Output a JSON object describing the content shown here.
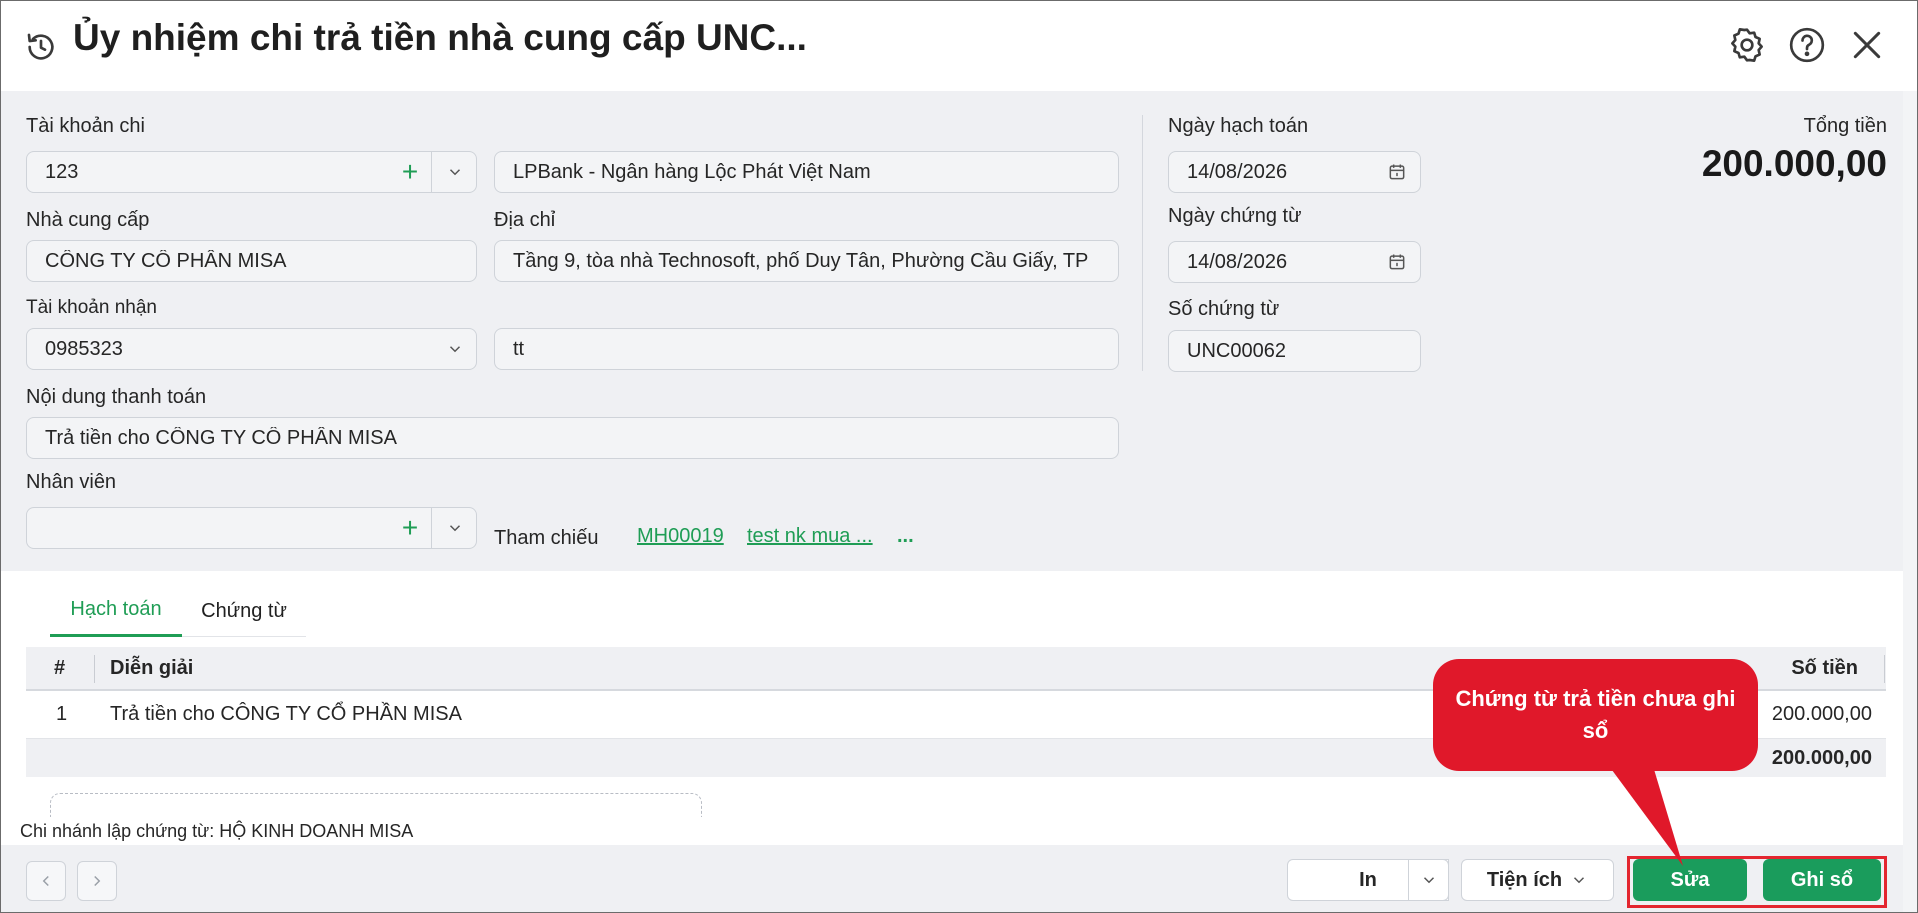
{
  "header": {
    "title": "Ủy nhiệm chi trả tiền nhà cung cấp UNC...",
    "icons": [
      "history-icon",
      "gear-icon",
      "help-icon",
      "close-icon"
    ]
  },
  "form": {
    "account_label": "Tài khoản chi",
    "account_value": "123",
    "bank_value": "LPBank - Ngân hàng Lộc Phát Việt Nam",
    "supplier_label": "Nhà cung cấp",
    "supplier_value": "CÔNG TY CÔ PHÂN MISA",
    "address_label": "Địa chỉ",
    "address_value": "Tầng 9, tòa nhà Technosoft, phố Duy Tân, Phường Cầu Giấy, TP",
    "receive_account_label": "Tài khoản nhận",
    "receive_account_value": "0985323",
    "receive_bank_value": "tt",
    "content_label": "Nội dung thanh toán",
    "content_value": "Trả tiền cho CÔNG TY CÔ PHÂN MISA",
    "employee_label": "Nhân viên",
    "employee_value": "",
    "reference_label": "Tham chiếu",
    "reference_links": [
      "MH00019",
      "test nk mua ...",
      "..."
    ]
  },
  "side": {
    "posting_date_label": "Ngày hạch toán",
    "posting_date_value": "14/08/2026",
    "voucher_date_label": "Ngày chứng từ",
    "voucher_date_value": "14/08/2026",
    "voucher_no_label": "Số chứng từ",
    "voucher_no_value": "UNC00062",
    "total_label": "Tổng tiền",
    "total_value": "200.000,00"
  },
  "tabs": [
    {
      "label": "Hạch toán",
      "active": true
    },
    {
      "label": "Chứng từ",
      "active": false
    }
  ],
  "grid": {
    "columns": [
      "#",
      "Diễn giải",
      "Số tiền"
    ],
    "rows": [
      {
        "no": "1",
        "description": "Trả tiền cho CÔNG TY CỔ PHẦN MISA",
        "amount": "200.000,00"
      }
    ],
    "sum": "200.000,00"
  },
  "footer": {
    "branch_text": "Chi nhánh lập chứng từ: HỘ KINH DOANH MISA",
    "print_label": "In",
    "utilities_label": "Tiện ích",
    "edit_label": "Sửa",
    "post_label": "Ghi sổ"
  },
  "callout": {
    "text": "Chứng từ trả tiền chưa ghi sổ"
  },
  "colors": {
    "accent_green": "#1a9c5c",
    "callout_red": "#e0182a",
    "highlight_red": "#e3262f",
    "form_bg": "#eff0f3"
  }
}
